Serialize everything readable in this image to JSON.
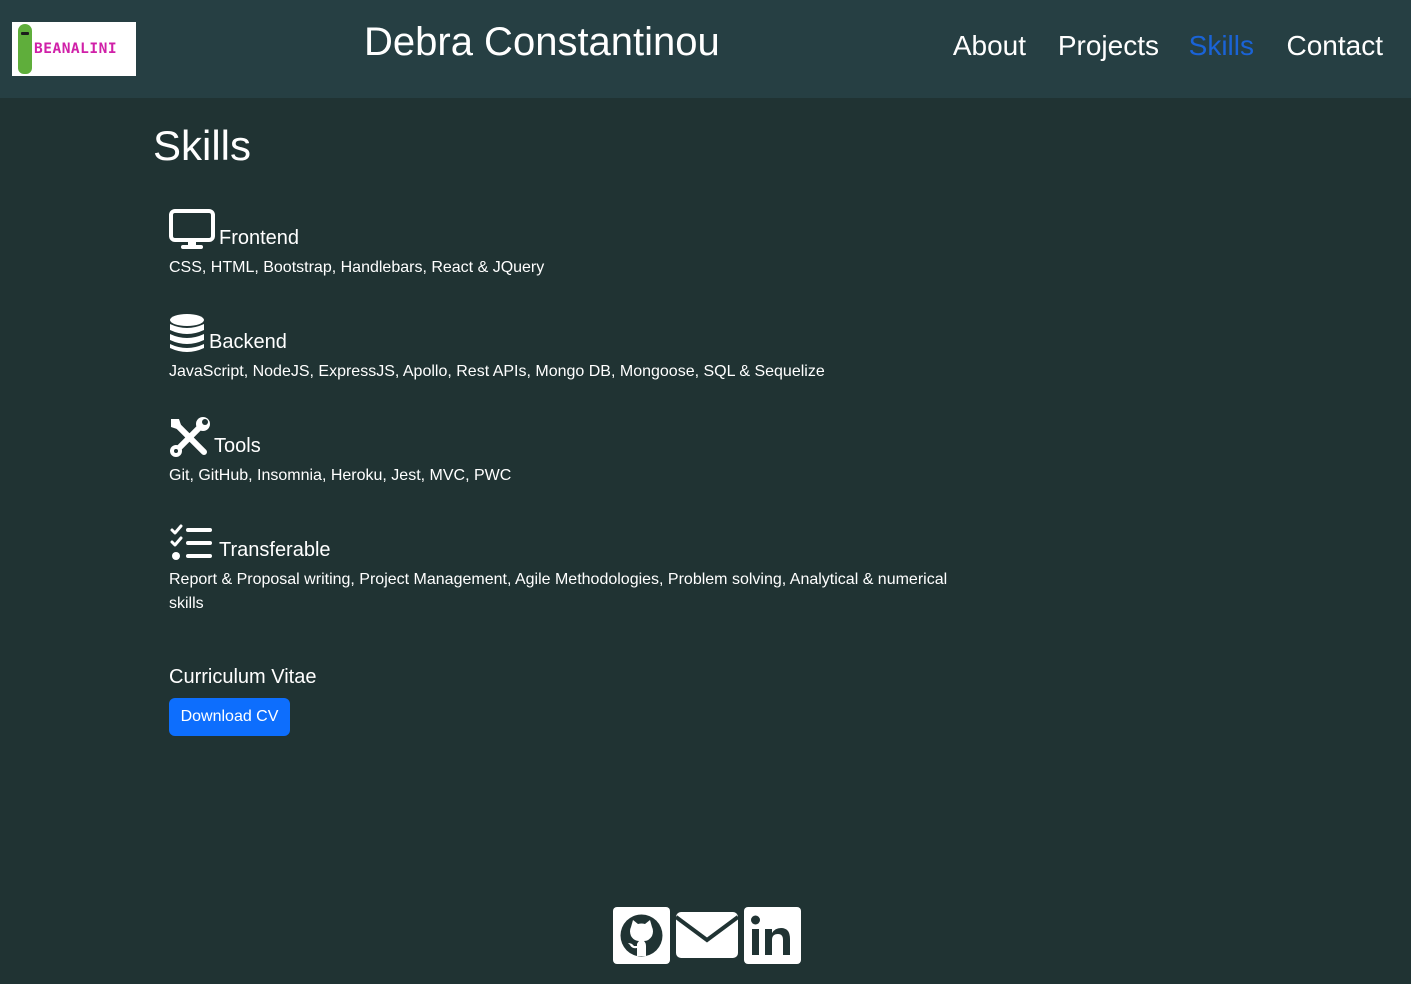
{
  "header": {
    "logo_text": "BEANALINI",
    "site_title": "Debra Constantinou",
    "nav": [
      {
        "label": "About"
      },
      {
        "label": "Projects"
      },
      {
        "label": "Skills",
        "active": true
      },
      {
        "label": "Contact"
      }
    ]
  },
  "main": {
    "heading": "Skills",
    "skills": [
      {
        "icon": "desktop-icon",
        "title": "Frontend",
        "items": "CSS, HTML, Bootstrap, Handlebars, React & JQuery"
      },
      {
        "icon": "database-icon",
        "title": "Backend",
        "items": "JavaScript, NodeJS, ExpressJS, Apollo, Rest APIs, Mongo DB, Mongoose, SQL & Sequelize"
      },
      {
        "icon": "tools-icon",
        "title": "Tools",
        "items": "Git, GitHub, Insomnia, Heroku, Jest, MVC, PWC"
      },
      {
        "icon": "checklist-icon",
        "title": "Transferable",
        "items": "Report & Proposal writing, Project Management, Agile Methodologies, Problem solving, Analytical & numerical skills"
      }
    ],
    "cv": {
      "label": "Curriculum Vitae",
      "button": "Download CV"
    }
  },
  "footer": {
    "socials": [
      {
        "icon": "github-icon"
      },
      {
        "icon": "envelope-icon"
      },
      {
        "icon": "linkedin-icon"
      }
    ]
  },
  "colors": {
    "background": "#203333",
    "header": "#263f43",
    "active_nav": "#1a63d6",
    "button": "#0d6efd"
  }
}
